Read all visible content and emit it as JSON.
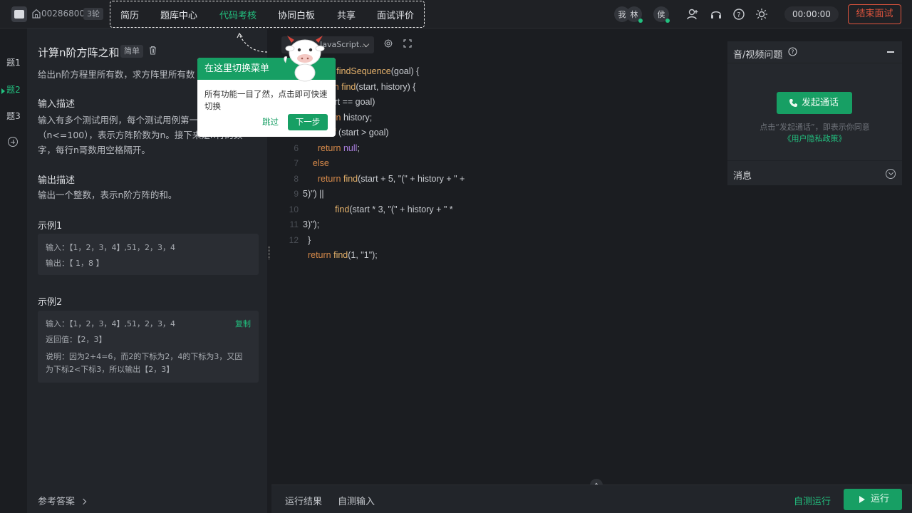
{
  "topbar": {
    "room_id": "00286800",
    "round": "3轮",
    "menu": [
      "简历",
      "题库中心",
      "代码考核",
      "协同白板",
      "共享",
      "面试评价"
    ],
    "active_menu": "代码考核",
    "avatars": [
      "我",
      "林",
      "侯"
    ],
    "timer": "00:00:00",
    "end_label": "结束面试",
    "accent": "#22c07f",
    "end_color": "#e0553e"
  },
  "rail": {
    "items": [
      "题1",
      "题2",
      "题3"
    ],
    "active": "题2"
  },
  "problem": {
    "title": "计算n阶方阵之和",
    "difficulty": "简单",
    "summary": "给出n阶方程里所有数，求方阵里所有数",
    "input_head": "输入描述",
    "input_text": "输入有多个测试用例，每个测试用例第一行为一个整数n（n<=100），表示方阵阶数为n。接下来是n行的数字，每行n哥数用空格隔开。",
    "output_head": "输出描述",
    "output_text": "输出一个整数，表示n阶方阵的和。",
    "example1_head": "示例1",
    "example1_input": "输入：【1，2，3，4】,51，2，3，4",
    "example1_output": "输出：【 1，8 】",
    "example2_head": "示例2",
    "example2_input": "输入：【1，2，3，4】,51，2，3，4",
    "example2_return": "返回值：【2，3】",
    "example2_note": "说明：因为2+4=6，而2的下标为2，4的下标为3，又因为下标2<下标3，所以输出【2，3】",
    "copy_label": "复制",
    "ref_answer": "参考答案"
  },
  "editor": {
    "language": "JavaScript...",
    "lines": [
      {
        "n": "",
        "text": "function findSequence(goal) {"
      },
      {
        "n": "",
        "text": "  function find(start, history) {"
      },
      {
        "n": "",
        "text": "    if (start == goal)"
      },
      {
        "n": "",
        "text": "      return history;"
      },
      {
        "n": "",
        "text": "    else if (start > goal)"
      },
      {
        "n": "6",
        "text": "      return null;"
      },
      {
        "n": "7",
        "text": "    else"
      },
      {
        "n": "8",
        "text": "      return find(start + 5, \"(\" + history + \" +"
      },
      {
        "n": "9",
        "text": "5)\") ||"
      },
      {
        "n": "10",
        "text": "             find(start * 3, \"(\" + history + \" *"
      },
      {
        "n": "11",
        "text": "3)\");"
      },
      {
        "n": "12",
        "text": "  }"
      },
      {
        "n": "",
        "text": "  return find(1, \"1\");"
      }
    ]
  },
  "bottom": {
    "tab_result": "运行结果",
    "tab_input": "自测输入",
    "self_run": "自测运行",
    "run": "运行"
  },
  "right_panel": {
    "title": "音/视频问题",
    "call_btn": "发起通话",
    "note": "点击“发起通话”，即表示你同意",
    "privacy": "《用户隐私政策》",
    "messages": "消息"
  },
  "guide": {
    "title": "在这里切换菜单",
    "body": "所有功能一目了然，点击即可快速切换",
    "skip": "跳过",
    "next": "下一步"
  }
}
